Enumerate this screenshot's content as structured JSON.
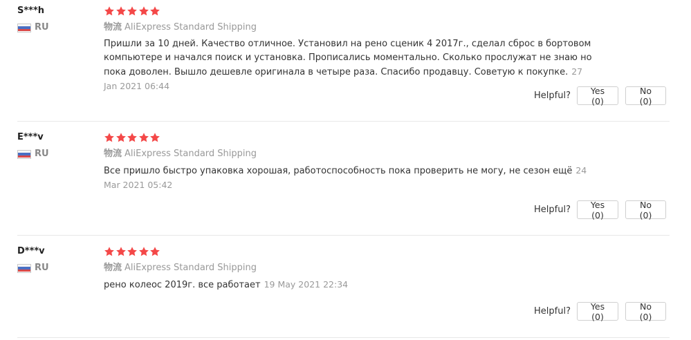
{
  "common": {
    "helpful_label": "Helpful?",
    "shipping_label": "物流",
    "star_color": "#f44848"
  },
  "reviews": [
    {
      "user": "S***h",
      "country": "RU",
      "rating": 5,
      "shipping": "AliExpress Standard Shipping",
      "text": "Пришли за 10 дней. Качество отличное. Установил на рено сценик 4 2017г., сделал сброс в бортовом компьютере и начался поиск и установка. Прописались моментально. Сколько прослужат не знаю но пока доволен. Вышло дешевле оригинала в четыре раза. Спасибо продавцу. Советую к покупке.",
      "date": "27 Jan 2021 06:44",
      "yes": "Yes (0)",
      "no": "No (0)"
    },
    {
      "user": "E***v",
      "country": "RU",
      "rating": 5,
      "shipping": "AliExpress Standard Shipping",
      "text": "Все пришло быстро упаковка хорошая, работоспособность пока проверить не могу, не сезон ещё",
      "date": "24 Mar 2021 05:42",
      "yes": "Yes (0)",
      "no": "No (0)"
    },
    {
      "user": "D***v",
      "country": "RU",
      "rating": 5,
      "shipping": "AliExpress Standard Shipping",
      "text": "рено колеос 2019г. все работает",
      "date": "19 May 2021 22:34",
      "yes": "Yes (0)",
      "no": "No (0)"
    }
  ]
}
